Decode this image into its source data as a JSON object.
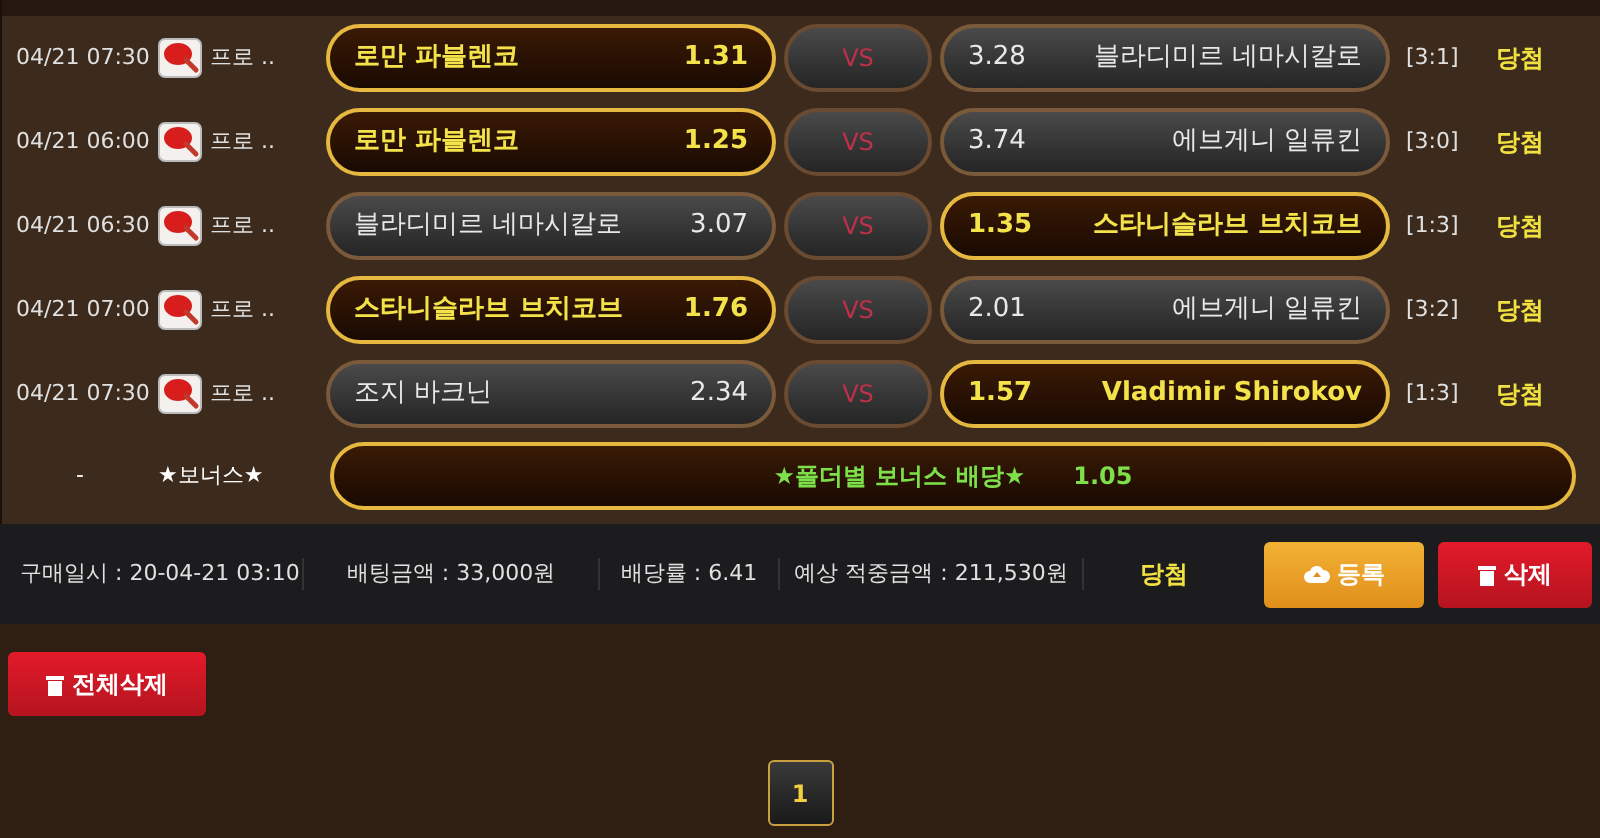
{
  "bets": [
    {
      "time": "04/21 07:30",
      "league": "프로 ..",
      "home": {
        "name": "로만 파블렌코",
        "odds": "1.31",
        "selected": true
      },
      "vs": "VS",
      "away": {
        "name": "블라디미르 네마시칼로",
        "odds": "3.28",
        "selected": false
      },
      "score": "[3:1]",
      "result": "당첨"
    },
    {
      "time": "04/21 06:00",
      "league": "프로 ..",
      "home": {
        "name": "로만 파블렌코",
        "odds": "1.25",
        "selected": true
      },
      "vs": "VS",
      "away": {
        "name": "에브게니 일류킨",
        "odds": "3.74",
        "selected": false
      },
      "score": "[3:0]",
      "result": "당첨"
    },
    {
      "time": "04/21 06:30",
      "league": "프로 ..",
      "home": {
        "name": "블라디미르 네마시칼로",
        "odds": "3.07",
        "selected": false
      },
      "vs": "VS",
      "away": {
        "name": "스타니슬라브 브치코브",
        "odds": "1.35",
        "selected": true
      },
      "score": "[1:3]",
      "result": "당첨"
    },
    {
      "time": "04/21 07:00",
      "league": "프로 ..",
      "home": {
        "name": "스타니슬라브 브치코브",
        "odds": "1.76",
        "selected": true
      },
      "vs": "VS",
      "away": {
        "name": "에브게니 일류킨",
        "odds": "2.01",
        "selected": false
      },
      "score": "[3:2]",
      "result": "당첨"
    },
    {
      "time": "04/21 07:30",
      "league": "프로 ..",
      "home": {
        "name": "조지 바크닌",
        "odds": "2.34",
        "selected": false
      },
      "vs": "VS",
      "away": {
        "name": "Vladimir Shirokov",
        "odds": "1.57",
        "selected": true
      },
      "score": "[1:3]",
      "result": "당첨"
    }
  ],
  "bonus": {
    "dash": "-",
    "label": "★보너스★",
    "text": "★폴더별 보너스 배당★",
    "odds": "1.05"
  },
  "summary": {
    "purchase": "구매일시 : 20-04-21 03:10",
    "amount": "배팅금액 : 33,000원",
    "rate": "배당률 : 6.41",
    "expected": "예상 적중금액 : 211,530원",
    "result": "당첨",
    "register": "등록",
    "delete": "삭제"
  },
  "delete_all": "전체삭제",
  "pagination": [
    {
      "label": "1",
      "selected": true
    }
  ]
}
